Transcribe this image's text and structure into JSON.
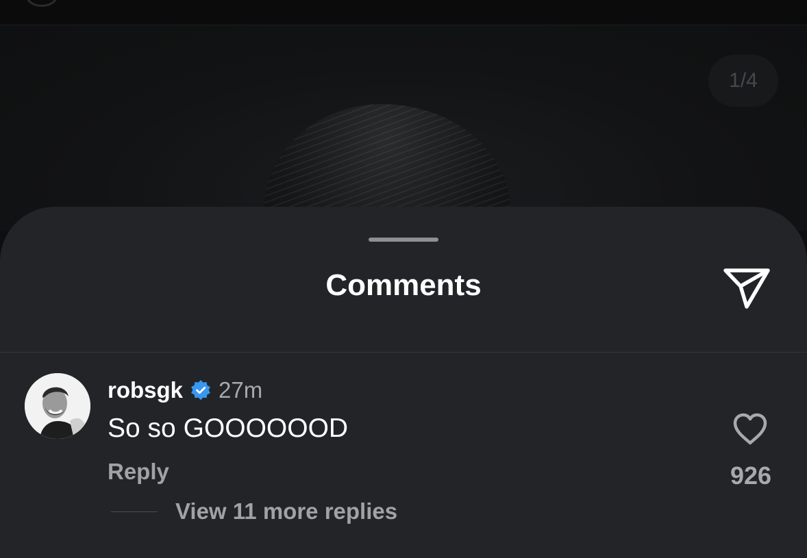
{
  "post": {
    "image_counter": "1/4"
  },
  "comments_sheet": {
    "title": "Comments",
    "share_icon": "paper-plane-icon"
  },
  "comment": {
    "username": "robsgk",
    "verified": true,
    "verified_icon": "verified-badge-icon",
    "verified_color": "#3897f0",
    "timestamp": "27m",
    "text": "So so GOOOOOOD",
    "reply_label": "Reply",
    "like_icon": "heart-outline-icon",
    "like_count": "926",
    "view_replies_label": "View 11 more replies"
  },
  "colors": {
    "sheet_background": "#232428",
    "primary_text": "#ffffff",
    "secondary_text": "#a7a9ae"
  }
}
